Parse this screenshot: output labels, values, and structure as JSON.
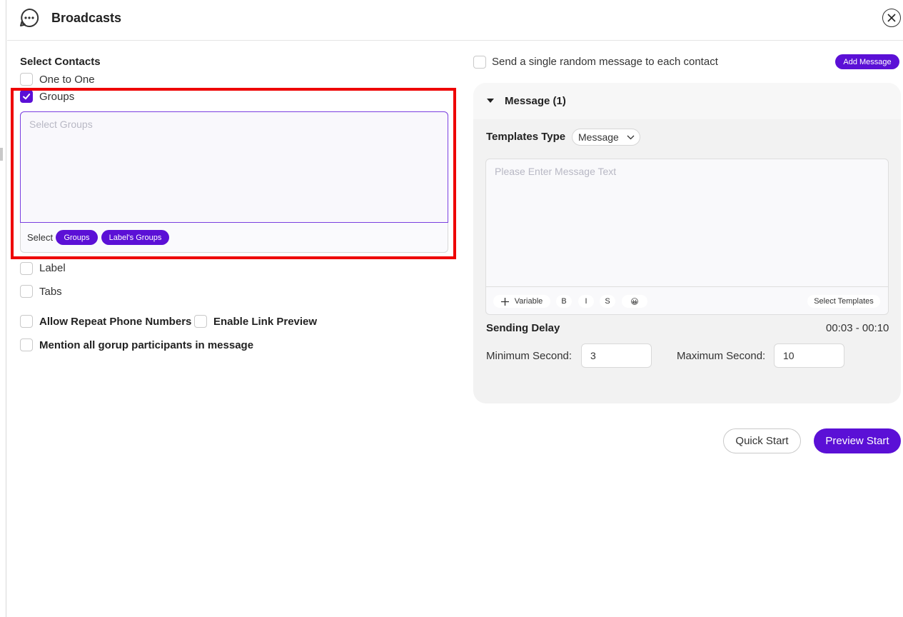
{
  "header": {
    "title": "Broadcasts",
    "icon": "chat-bubble-icon",
    "close_icon": "close-icon"
  },
  "left": {
    "section_title": "Select Contacts",
    "one_to_one": {
      "label": "One to One",
      "checked": false
    },
    "groups": {
      "label": "Groups",
      "checked": true
    },
    "groups_selector": {
      "placeholder": "Select Groups",
      "select_label": "Select",
      "pill_groups": "Groups",
      "pill_label_groups": "Label's Groups"
    },
    "label_option": {
      "label": "Label",
      "checked": false
    },
    "tabs_option": {
      "label": "Tabs",
      "checked": false
    },
    "allow_repeat": {
      "label": "Allow Repeat Phone Numbers",
      "checked": false
    },
    "link_preview": {
      "label": "Enable Link Preview",
      "checked": false
    },
    "mention_all": {
      "label": "Mention all gorup participants in message",
      "checked": false
    }
  },
  "right": {
    "random_message": {
      "label": "Send a single random message to each contact",
      "checked": false
    },
    "add_message_label": "Add Message",
    "message_panel": {
      "title": "Message (1)",
      "templates_type_label": "Templates Type",
      "templates_type_value": "Message",
      "message_placeholder": "Please Enter Message Text",
      "toolbar": {
        "variable": "Variable",
        "bold": "B",
        "italic": "I",
        "strike": "S",
        "emoji": "😀",
        "select_templates": "Select Templates"
      },
      "sending_delay_label": "Sending Delay",
      "sending_delay_range": "00:03 - 00:10",
      "min_label": "Minimum Second",
      "min_value": "3",
      "max_label": "Maximum Second",
      "max_value": "10"
    },
    "quick_start": "Quick Start",
    "preview_start": "Preview Start"
  },
  "colors": {
    "accent": "#5b10d6",
    "highlight": "#ee0000",
    "panel_bg": "#f2f2f2"
  }
}
